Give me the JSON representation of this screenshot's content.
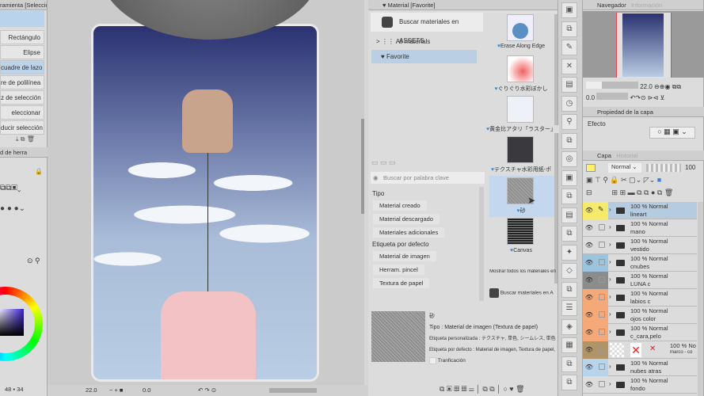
{
  "left_panel": {
    "title": "ramienta [Selección",
    "items": [
      "Rectángulo",
      "Elipse",
      "cuadre de lazo",
      "re de polilínea",
      "z de selección",
      "eleccionar",
      "ducir selección"
    ],
    "selected_index": 2,
    "subtab": "d de herra",
    "bottom_numbers": [
      "48",
      "34"
    ]
  },
  "status_bar": {
    "zoom": "22.0",
    "angle": "0.0"
  },
  "material": {
    "tab": "Material [Favorite]",
    "assets_button": "Buscar materiales en ASSETS",
    "tree": [
      {
        "label": "All materials"
      },
      {
        "label": "Favorite"
      }
    ],
    "search_placeholder": "Buscar por palabra clave",
    "tag_groups": [
      {
        "title": "Tipo",
        "tags": [
          "Material creado",
          "Material descargado",
          "Materiales adicionales"
        ]
      },
      {
        "title": "Etiqueta por defecto",
        "tags": [
          "Material de imagen",
          "Herram. pincel",
          "Textura de papel"
        ]
      }
    ],
    "thumbnails": [
      "Erase Along Edge",
      "ぐりぐり水彩ぼかし",
      "黄金比アタリ「ラスター」",
      "テクスチャ水彩用紙-ポ",
      "砂",
      "Canvas"
    ],
    "selected_thumbnail": 4,
    "show_all": "Mostrar todos los materiales en",
    "assets_small": "Buscar materiales en A",
    "detail": {
      "name": "砂",
      "type": "Tipo : Material de imagen (Textura de papel)",
      "custom_tags": "Etiqueta personalizada : テクスチャ, 単色, シームレス, 単色パター",
      "default_tags": "Etiqueta por defecto : Material de imagen, Textura de papel, Fo",
      "tiling": "Tranficación"
    }
  },
  "navigator": {
    "tab": "Navegador",
    "tab2": "Información",
    "zoom": "22.0",
    "angle": "0.0"
  },
  "layer_property": {
    "tab": "Propiedad de la capa",
    "effect": "Efecto"
  },
  "layers": {
    "tab": "Capa",
    "tab2": "Historial",
    "blend_mode": "Normal",
    "opacity": "100",
    "items": [
      {
        "mode": "100 % Normal",
        "name": "lineart",
        "color": "#f5ea6a"
      },
      {
        "mode": "100 % Normal",
        "name": "mano",
        "color": ""
      },
      {
        "mode": "100 % Normal",
        "name": "vestido",
        "color": ""
      },
      {
        "mode": "100 % Normal",
        "name": "cnubes",
        "color": "#9cc4de"
      },
      {
        "mode": "100 % Normal",
        "name": "LUNA c",
        "color": "#8c8c8c"
      },
      {
        "mode": "100 % Normal",
        "name": "labios c",
        "color": "#f5a878"
      },
      {
        "mode": "100 % Normal",
        "name": "ojos color",
        "color": "#f5a878"
      },
      {
        "mode": "100 % Normal",
        "name": "c_cara,pelo",
        "color": "#f5a878"
      },
      {
        "mode": "100 % No",
        "name": "marco - co",
        "color": "#b09468"
      },
      {
        "mode": "100 % Normal",
        "name": "nubes atras",
        "color": "#b8d4ea"
      },
      {
        "mode": "100 % Normal",
        "name": "fondo",
        "color": ""
      }
    ]
  }
}
